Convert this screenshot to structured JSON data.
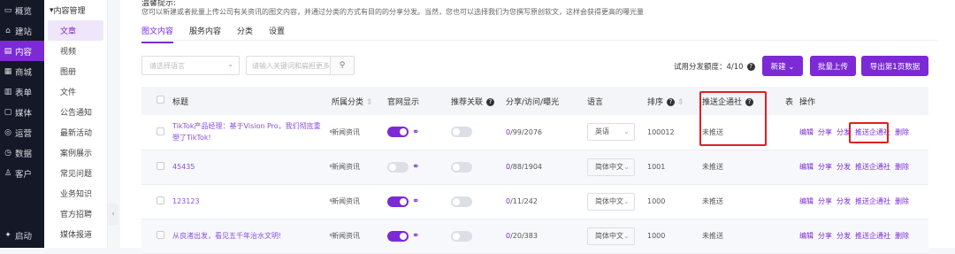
{
  "left_nav": {
    "items": [
      {
        "icon": "▭",
        "label": "概览"
      },
      {
        "icon": "⌂",
        "label": "建站"
      },
      {
        "icon": "▤",
        "label": "内容",
        "active": true
      },
      {
        "icon": "▦",
        "label": "商城"
      },
      {
        "icon": "▥",
        "label": "表单"
      },
      {
        "icon": "▢",
        "label": "媒体"
      },
      {
        "icon": "◎",
        "label": "运营"
      },
      {
        "icon": "◷",
        "label": "数据"
      },
      {
        "icon": "♙",
        "label": "客户"
      }
    ],
    "launch": {
      "icon": "✦",
      "label": "启动"
    }
  },
  "sub_nav": {
    "header": "内容管理",
    "items": [
      "文章",
      "视频",
      "图册",
      "文件",
      "公告通知",
      "最新活动",
      "案例展示",
      "常见问题",
      "业务知识",
      "官方招聘",
      "媒体报道"
    ]
  },
  "page": {
    "title": "温馨提示:",
    "description": "您可以新建或者批量上传公司有关资讯的图文内容，并通过分类的方式有目的的分享分发。当然，您也可以选择我们为您撰写原创软文，这样会获得更高的曝光量"
  },
  "tabs": [
    "图文内容",
    "服务内容",
    "分类",
    "设置"
  ],
  "filters": {
    "language_placeholder": "请选择语言",
    "search_placeholder": "请输入关键词和扁担更多"
  },
  "quota_text": "试用分发额度：4/10",
  "buttons": {
    "new": "新建 ⌄",
    "batch_upload": "批量上传",
    "export": "导出第1页数据"
  },
  "table": {
    "headers": [
      "",
      "标题",
      "所属分类",
      "官网显示",
      "推荐关联",
      "分享/访问/曝光",
      "语言",
      "排序",
      "推送企通社",
      "表",
      "操作"
    ],
    "rows": [
      {
        "title": "TikTok产品经理：基于Vision Pro，我们彻底重塑了TikTok!",
        "category": "新闻资讯",
        "show": true,
        "rec": false,
        "stats_a": "0",
        "stats_b": "/99/2076",
        "lang": "英语",
        "sort": "100012",
        "push": "未推送"
      },
      {
        "title": "45435",
        "category": "新闻资讯",
        "show": false,
        "rec": false,
        "stats_a": "0",
        "stats_b": "/88/1904",
        "lang": "简体中文",
        "sort": "1001",
        "push": "未推送"
      },
      {
        "title": "123123",
        "category": "新闻资讯",
        "show": true,
        "rec": false,
        "stats_a": "0",
        "stats_b": "/11/242",
        "lang": "简体中文",
        "sort": "1000",
        "push": "未推送"
      },
      {
        "title": "从良渚出发，看见五千年治水文明!",
        "category": "新闻资讯",
        "show": true,
        "rec": false,
        "stats_a": "0",
        "stats_b": "/20/383",
        "lang": "简体中文",
        "sort": "1000",
        "push": "未推送"
      }
    ],
    "ops": [
      "编辑",
      "分享",
      "分发",
      "推送企通社",
      "删除"
    ]
  }
}
